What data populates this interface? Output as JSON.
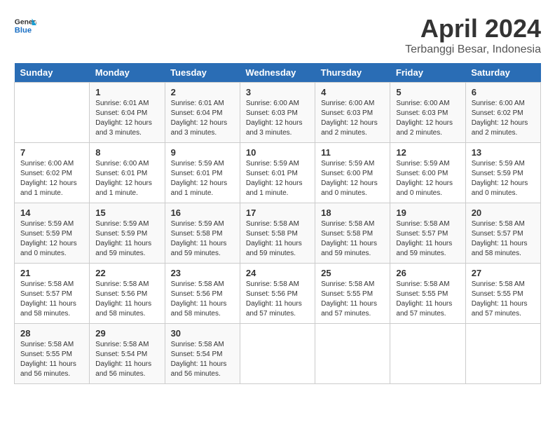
{
  "header": {
    "logo_line1": "General",
    "logo_line2": "Blue",
    "title": "April 2024",
    "subtitle": "Terbanggi Besar, Indonesia"
  },
  "calendar": {
    "days_of_week": [
      "Sunday",
      "Monday",
      "Tuesday",
      "Wednesday",
      "Thursday",
      "Friday",
      "Saturday"
    ],
    "weeks": [
      [
        {
          "day": "",
          "sunrise": "",
          "sunset": "",
          "daylight": ""
        },
        {
          "day": "1",
          "sunrise": "Sunrise: 6:01 AM",
          "sunset": "Sunset: 6:04 PM",
          "daylight": "Daylight: 12 hours and 3 minutes."
        },
        {
          "day": "2",
          "sunrise": "Sunrise: 6:01 AM",
          "sunset": "Sunset: 6:04 PM",
          "daylight": "Daylight: 12 hours and 3 minutes."
        },
        {
          "day": "3",
          "sunrise": "Sunrise: 6:00 AM",
          "sunset": "Sunset: 6:03 PM",
          "daylight": "Daylight: 12 hours and 3 minutes."
        },
        {
          "day": "4",
          "sunrise": "Sunrise: 6:00 AM",
          "sunset": "Sunset: 6:03 PM",
          "daylight": "Daylight: 12 hours and 2 minutes."
        },
        {
          "day": "5",
          "sunrise": "Sunrise: 6:00 AM",
          "sunset": "Sunset: 6:03 PM",
          "daylight": "Daylight: 12 hours and 2 minutes."
        },
        {
          "day": "6",
          "sunrise": "Sunrise: 6:00 AM",
          "sunset": "Sunset: 6:02 PM",
          "daylight": "Daylight: 12 hours and 2 minutes."
        }
      ],
      [
        {
          "day": "7",
          "sunrise": "Sunrise: 6:00 AM",
          "sunset": "Sunset: 6:02 PM",
          "daylight": "Daylight: 12 hours and 1 minute."
        },
        {
          "day": "8",
          "sunrise": "Sunrise: 6:00 AM",
          "sunset": "Sunset: 6:01 PM",
          "daylight": "Daylight: 12 hours and 1 minute."
        },
        {
          "day": "9",
          "sunrise": "Sunrise: 5:59 AM",
          "sunset": "Sunset: 6:01 PM",
          "daylight": "Daylight: 12 hours and 1 minute."
        },
        {
          "day": "10",
          "sunrise": "Sunrise: 5:59 AM",
          "sunset": "Sunset: 6:01 PM",
          "daylight": "Daylight: 12 hours and 1 minute."
        },
        {
          "day": "11",
          "sunrise": "Sunrise: 5:59 AM",
          "sunset": "Sunset: 6:00 PM",
          "daylight": "Daylight: 12 hours and 0 minutes."
        },
        {
          "day": "12",
          "sunrise": "Sunrise: 5:59 AM",
          "sunset": "Sunset: 6:00 PM",
          "daylight": "Daylight: 12 hours and 0 minutes."
        },
        {
          "day": "13",
          "sunrise": "Sunrise: 5:59 AM",
          "sunset": "Sunset: 5:59 PM",
          "daylight": "Daylight: 12 hours and 0 minutes."
        }
      ],
      [
        {
          "day": "14",
          "sunrise": "Sunrise: 5:59 AM",
          "sunset": "Sunset: 5:59 PM",
          "daylight": "Daylight: 12 hours and 0 minutes."
        },
        {
          "day": "15",
          "sunrise": "Sunrise: 5:59 AM",
          "sunset": "Sunset: 5:59 PM",
          "daylight": "Daylight: 11 hours and 59 minutes."
        },
        {
          "day": "16",
          "sunrise": "Sunrise: 5:59 AM",
          "sunset": "Sunset: 5:58 PM",
          "daylight": "Daylight: 11 hours and 59 minutes."
        },
        {
          "day": "17",
          "sunrise": "Sunrise: 5:58 AM",
          "sunset": "Sunset: 5:58 PM",
          "daylight": "Daylight: 11 hours and 59 minutes."
        },
        {
          "day": "18",
          "sunrise": "Sunrise: 5:58 AM",
          "sunset": "Sunset: 5:58 PM",
          "daylight": "Daylight: 11 hours and 59 minutes."
        },
        {
          "day": "19",
          "sunrise": "Sunrise: 5:58 AM",
          "sunset": "Sunset: 5:57 PM",
          "daylight": "Daylight: 11 hours and 59 minutes."
        },
        {
          "day": "20",
          "sunrise": "Sunrise: 5:58 AM",
          "sunset": "Sunset: 5:57 PM",
          "daylight": "Daylight: 11 hours and 58 minutes."
        }
      ],
      [
        {
          "day": "21",
          "sunrise": "Sunrise: 5:58 AM",
          "sunset": "Sunset: 5:57 PM",
          "daylight": "Daylight: 11 hours and 58 minutes."
        },
        {
          "day": "22",
          "sunrise": "Sunrise: 5:58 AM",
          "sunset": "Sunset: 5:56 PM",
          "daylight": "Daylight: 11 hours and 58 minutes."
        },
        {
          "day": "23",
          "sunrise": "Sunrise: 5:58 AM",
          "sunset": "Sunset: 5:56 PM",
          "daylight": "Daylight: 11 hours and 58 minutes."
        },
        {
          "day": "24",
          "sunrise": "Sunrise: 5:58 AM",
          "sunset": "Sunset: 5:56 PM",
          "daylight": "Daylight: 11 hours and 57 minutes."
        },
        {
          "day": "25",
          "sunrise": "Sunrise: 5:58 AM",
          "sunset": "Sunset: 5:55 PM",
          "daylight": "Daylight: 11 hours and 57 minutes."
        },
        {
          "day": "26",
          "sunrise": "Sunrise: 5:58 AM",
          "sunset": "Sunset: 5:55 PM",
          "daylight": "Daylight: 11 hours and 57 minutes."
        },
        {
          "day": "27",
          "sunrise": "Sunrise: 5:58 AM",
          "sunset": "Sunset: 5:55 PM",
          "daylight": "Daylight: 11 hours and 57 minutes."
        }
      ],
      [
        {
          "day": "28",
          "sunrise": "Sunrise: 5:58 AM",
          "sunset": "Sunset: 5:55 PM",
          "daylight": "Daylight: 11 hours and 56 minutes."
        },
        {
          "day": "29",
          "sunrise": "Sunrise: 5:58 AM",
          "sunset": "Sunset: 5:54 PM",
          "daylight": "Daylight: 11 hours and 56 minutes."
        },
        {
          "day": "30",
          "sunrise": "Sunrise: 5:58 AM",
          "sunset": "Sunset: 5:54 PM",
          "daylight": "Daylight: 11 hours and 56 minutes."
        },
        {
          "day": "",
          "sunrise": "",
          "sunset": "",
          "daylight": ""
        },
        {
          "day": "",
          "sunrise": "",
          "sunset": "",
          "daylight": ""
        },
        {
          "day": "",
          "sunrise": "",
          "sunset": "",
          "daylight": ""
        },
        {
          "day": "",
          "sunrise": "",
          "sunset": "",
          "daylight": ""
        }
      ]
    ]
  }
}
